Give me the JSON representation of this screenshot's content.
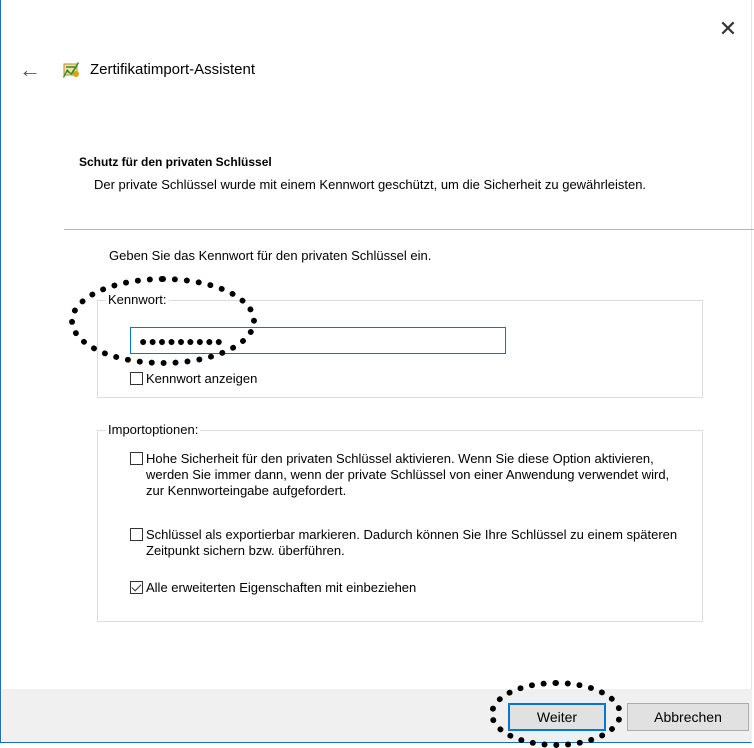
{
  "window": {
    "title": "Zertifikatimport-Assistent",
    "close_glyph": "✕",
    "back_glyph": "←"
  },
  "section": {
    "title": "Schutz für den privaten Schlüssel",
    "description": "Der private Schlüssel wurde mit einem Kennwort geschützt, um die Sicherheit zu gewährleisten."
  },
  "instruction": "Geben Sie das Kennwort für den privaten Schlüssel ein.",
  "password_group": {
    "label": "Kennwort:",
    "value": "●●●●●●●●●",
    "show_password_label": "Kennwort anzeigen",
    "show_password_checked": false
  },
  "import_options": {
    "label": "Importoptionen:",
    "options": [
      {
        "label": "Hohe Sicherheit für den privaten Schlüssel aktivieren. Wenn Sie diese Option aktivieren, werden Sie immer dann, wenn der private Schlüssel von einer Anwendung verwendet wird, zur Kennworteingabe aufgefordert.",
        "checked": false
      },
      {
        "label": "Schlüssel als exportierbar markieren. Dadurch können Sie Ihre Schlüssel zu einem späteren Zeitpunkt sichern bzw. überführen.",
        "checked": false
      },
      {
        "label": "Alle erweiterten Eigenschaften mit einbeziehen",
        "checked": true
      }
    ]
  },
  "footer": {
    "next_label": "Weiter",
    "cancel_label": "Abbrechen"
  },
  "colors": {
    "accent": "#0078d7",
    "footer_bg": "#f0f0f0"
  }
}
